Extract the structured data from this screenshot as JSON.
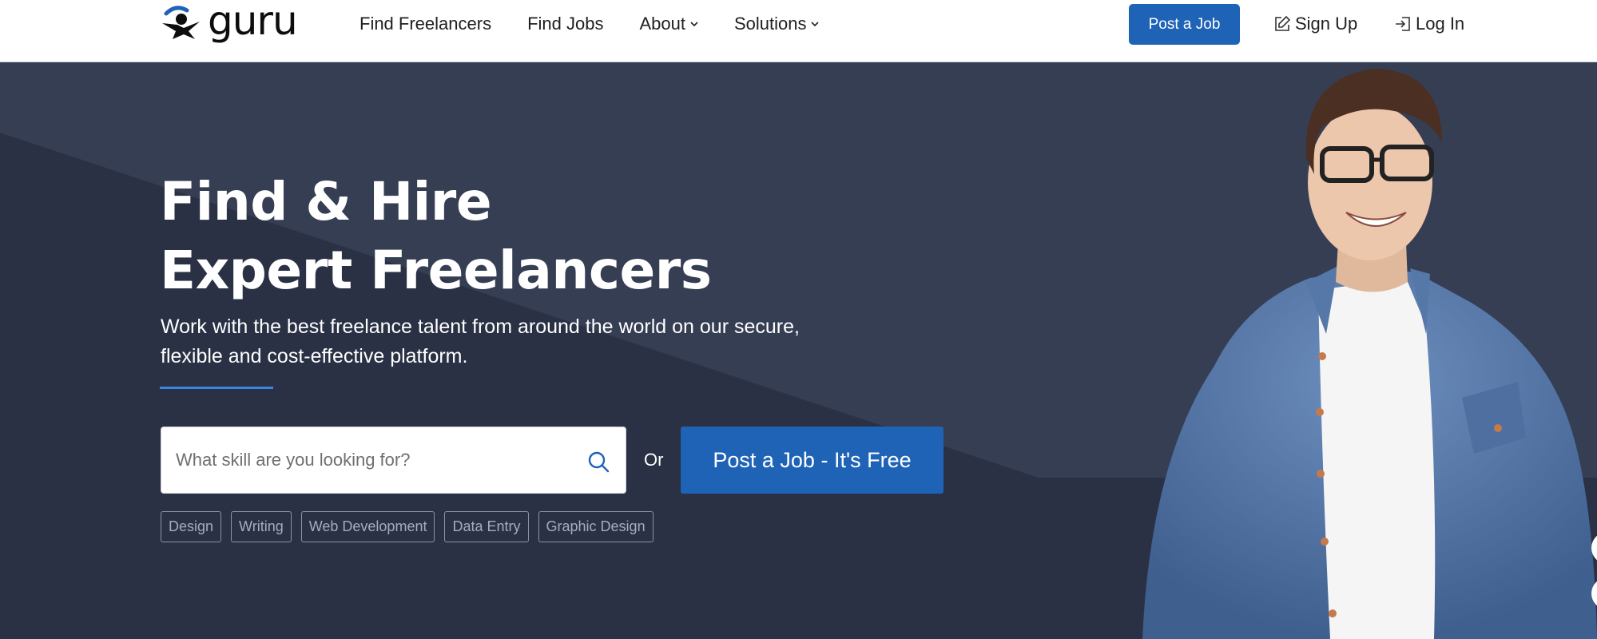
{
  "header": {
    "logo_text": "guru",
    "nav": [
      {
        "label": "Find Freelancers",
        "dropdown": false
      },
      {
        "label": "Find Jobs",
        "dropdown": false
      },
      {
        "label": "About",
        "dropdown": true
      },
      {
        "label": "Solutions",
        "dropdown": true
      }
    ],
    "post_job_label": "Post a Job",
    "signup_label": "Sign Up",
    "login_label": "Log In"
  },
  "hero": {
    "title_line1": "Find & Hire",
    "title_line2": "Expert Freelancers",
    "subtitle": "Work with the best freelance talent from around the world on our secure, flexible and cost-effective platform.",
    "search_placeholder": "What skill are you looking for?",
    "or_label": "Or",
    "post_free_label": "Post a Job - It's Free",
    "tags": [
      "Design",
      "Writing",
      "Web Development",
      "Data Entry",
      "Graphic Design"
    ]
  },
  "colors": {
    "brand_blue": "#1f63b6",
    "hero_bg": "#2b3247",
    "accent_line": "#3a86e0"
  }
}
